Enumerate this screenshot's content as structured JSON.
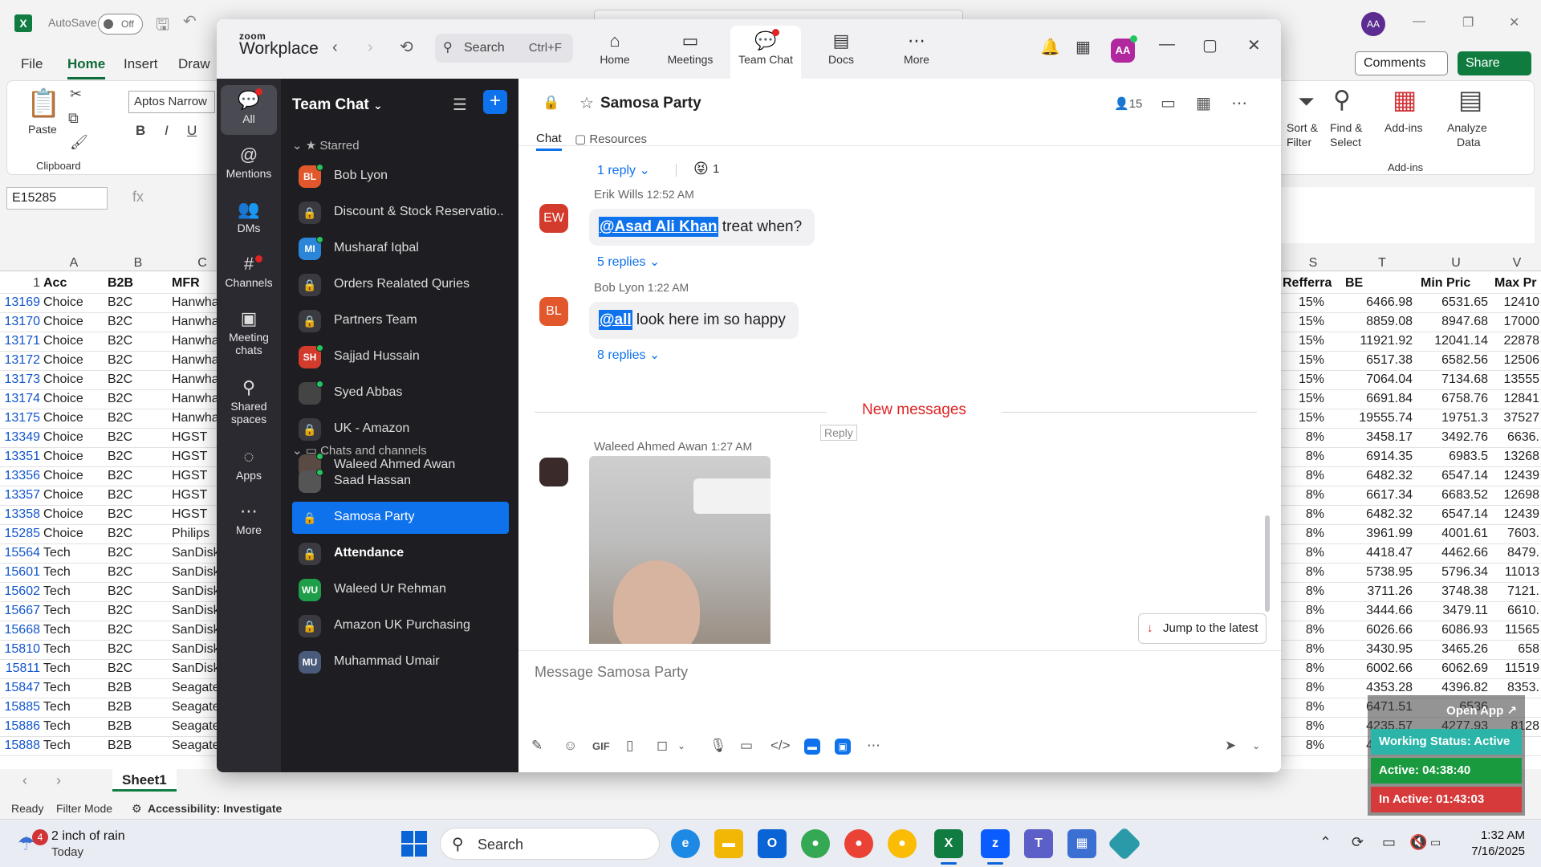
{
  "excel": {
    "autosave_label": "AutoSave",
    "autosave_state": "Off",
    "user_initials": "AA",
    "menu": [
      "File",
      "Home",
      "Insert",
      "Draw"
    ],
    "font_name": "Aptos Narrow",
    "paste_label": "Paste",
    "clipboard_label": "Clipboard",
    "comments_label": "Comments",
    "share_label": "Share",
    "sort_filter_label": "Sort &",
    "sort_filter_label2": "Filter",
    "find_select_label": "Find &",
    "find_select_label2": "Select",
    "addins_label": "Add-ins",
    "addins_group": "Add-ins",
    "analyze_label": "Analyze",
    "analyze_label2": "Data",
    "name_box": "E15285",
    "fx": "fx",
    "col_letters_left": [
      "A",
      "B",
      "C"
    ],
    "col_letters_right": [
      "S",
      "T",
      "U",
      "V"
    ],
    "row1_num": "1",
    "headers_left": [
      "Acc",
      "B2B",
      "MFR"
    ],
    "headers_right": [
      "Refferra",
      "BE",
      "Min Pric",
      "Max Pr"
    ],
    "rows": [
      {
        "n": "13169",
        "a": "Choice",
        "b": "B2C",
        "c": "Hanwha",
        "s": "15%",
        "t": "6466.98",
        "u": "6531.65",
        "v": "12410"
      },
      {
        "n": "13170",
        "a": "Choice",
        "b": "B2C",
        "c": "Hanwha",
        "s": "15%",
        "t": "8859.08",
        "u": "8947.68",
        "v": "17000"
      },
      {
        "n": "13171",
        "a": "Choice",
        "b": "B2C",
        "c": "Hanwha",
        "s": "15%",
        "t": "11921.92",
        "u": "12041.14",
        "v": "22878"
      },
      {
        "n": "13172",
        "a": "Choice",
        "b": "B2C",
        "c": "Hanwha",
        "s": "15%",
        "t": "6517.38",
        "u": "6582.56",
        "v": "12506"
      },
      {
        "n": "13173",
        "a": "Choice",
        "b": "B2C",
        "c": "Hanwha",
        "s": "15%",
        "t": "7064.04",
        "u": "7134.68",
        "v": "13555"
      },
      {
        "n": "13174",
        "a": "Choice",
        "b": "B2C",
        "c": "Hanwha",
        "s": "15%",
        "t": "6691.84",
        "u": "6758.76",
        "v": "12841"
      },
      {
        "n": "13175",
        "a": "Choice",
        "b": "B2C",
        "c": "Hanwha",
        "s": "15%",
        "t": "19555.74",
        "u": "19751.3",
        "v": "37527"
      },
      {
        "n": "13349",
        "a": "Choice",
        "b": "B2C",
        "c": "HGST",
        "s": "8%",
        "t": "3458.17",
        "u": "3492.76",
        "v": "6636."
      },
      {
        "n": "13351",
        "a": "Choice",
        "b": "B2C",
        "c": "HGST",
        "s": "8%",
        "t": "6914.35",
        "u": "6983.5",
        "v": "13268"
      },
      {
        "n": "13356",
        "a": "Choice",
        "b": "B2C",
        "c": "HGST",
        "s": "8%",
        "t": "6482.32",
        "u": "6547.14",
        "v": "12439"
      },
      {
        "n": "13357",
        "a": "Choice",
        "b": "B2C",
        "c": "HGST",
        "s": "8%",
        "t": "6617.34",
        "u": "6683.52",
        "v": "12698"
      },
      {
        "n": "13358",
        "a": "Choice",
        "b": "B2C",
        "c": "HGST",
        "s": "8%",
        "t": "6482.32",
        "u": "6547.14",
        "v": "12439"
      },
      {
        "n": "15285",
        "a": "Choice",
        "b": "B2C",
        "c": "Philips",
        "s": "8%",
        "t": "3961.99",
        "u": "4001.61",
        "v": "7603."
      },
      {
        "n": "15564",
        "a": "Tech",
        "b": "B2C",
        "c": "SanDisk",
        "s": "8%",
        "t": "4418.47",
        "u": "4462.66",
        "v": "8479."
      },
      {
        "n": "15601",
        "a": "Tech",
        "b": "B2C",
        "c": "SanDisk",
        "s": "8%",
        "t": "5738.95",
        "u": "5796.34",
        "v": "11013"
      },
      {
        "n": "15602",
        "a": "Tech",
        "b": "B2C",
        "c": "SanDisk",
        "s": "8%",
        "t": "3711.26",
        "u": "3748.38",
        "v": "7121."
      },
      {
        "n": "15667",
        "a": "Tech",
        "b": "B2C",
        "c": "SanDisk",
        "s": "8%",
        "t": "3444.66",
        "u": "3479.11",
        "v": "6610."
      },
      {
        "n": "15668",
        "a": "Tech",
        "b": "B2C",
        "c": "SanDisk",
        "s": "8%",
        "t": "6026.66",
        "u": "6086.93",
        "v": "11565"
      },
      {
        "n": "15810",
        "a": "Tech",
        "b": "B2C",
        "c": "SanDisk",
        "s": "8%",
        "t": "3430.95",
        "u": "3465.26",
        "v": "658"
      },
      {
        "n": "15811",
        "a": "Tech",
        "b": "B2C",
        "c": "SanDisk",
        "s": "8%",
        "t": "6002.66",
        "u": "6062.69",
        "v": "11519"
      },
      {
        "n": "15847",
        "a": "Tech",
        "b": "B2B",
        "c": "Seagate",
        "s": "8%",
        "t": "4353.28",
        "u": "4396.82",
        "v": "8353."
      },
      {
        "n": "15885",
        "a": "Tech",
        "b": "B2B",
        "c": "Seagate",
        "s": "8%",
        "t": "6471.51",
        "u": "6536",
        "v": ""
      },
      {
        "n": "15886",
        "a": "Tech",
        "b": "B2B",
        "c": "Seagate",
        "s": "8%",
        "t": "4235.57",
        "u": "4277.93",
        "v": "8128"
      },
      {
        "n": "15888",
        "a": "Tech",
        "b": "B2B",
        "c": "Seagate",
        "s": "8%",
        "t": "4641.85",
        "u": "4688.32",
        "v": ""
      }
    ],
    "sheet_name": "Sheet1",
    "status_ready": "Ready",
    "status_filter": "Filter Mode",
    "status_access": "Accessibility: Investigate"
  },
  "zoom": {
    "brand_small": "zoom",
    "brand_big": "Workplace",
    "search_label": "Search",
    "search_shortcut": "Ctrl+F",
    "tabs": [
      {
        "label": "Home",
        "icon": "⌂"
      },
      {
        "label": "Meetings",
        "icon": "▭"
      },
      {
        "label": "Team Chat",
        "icon": "💬"
      },
      {
        "label": "Docs",
        "icon": "▤"
      },
      {
        "label": "More",
        "icon": "⋯"
      }
    ],
    "user_initials": "AA",
    "rail": [
      {
        "label": "All",
        "icon": "💬"
      },
      {
        "label": "Mentions",
        "icon": "@"
      },
      {
        "label": "DMs",
        "icon": "👥"
      },
      {
        "label": "Channels",
        "icon": "#"
      },
      {
        "label": "Meeting chats",
        "icon": "▣"
      },
      {
        "label": "Shared spaces",
        "icon": "⚲"
      },
      {
        "label": "Apps",
        "icon": "◌"
      },
      {
        "label": "More",
        "icon": "⋯"
      }
    ],
    "list_title": "Team Chat",
    "starred_label": "Starred",
    "chats_label": "Chats and channels",
    "starred": [
      {
        "name": "Bob Lyon",
        "initials": "BL",
        "color": "#e2572b",
        "lock": false,
        "online": true
      },
      {
        "name": "Discount & Stock Reservatio...",
        "initials": "",
        "color": "",
        "lock": true,
        "online": false
      },
      {
        "name": "Musharaf Iqbal",
        "initials": "MI",
        "color": "#2b86d9",
        "lock": false,
        "online": true
      },
      {
        "name": "Orders Realated Quries",
        "initials": "",
        "color": "",
        "lock": true,
        "online": false
      },
      {
        "name": "Partners Team",
        "initials": "",
        "color": "",
        "lock": true,
        "online": false
      },
      {
        "name": "Sajjad Hussain",
        "initials": "SH",
        "color": "#d33b2c",
        "lock": false,
        "online": true
      },
      {
        "name": "Syed Abbas",
        "initials": "",
        "color": "#444",
        "lock": false,
        "online": true
      },
      {
        "name": "UK - Amazon",
        "initials": "",
        "color": "",
        "lock": true,
        "online": false
      },
      {
        "name": "Waleed Ahmed Awan",
        "initials": "",
        "color": "#5a4a44",
        "lock": false,
        "online": true
      }
    ],
    "chats": [
      {
        "name": "Saad Hassan",
        "initials": "",
        "color": "#555",
        "lock": false,
        "online": true,
        "sel": false,
        "bold": false
      },
      {
        "name": "Samosa Party",
        "initials": "",
        "color": "",
        "lock": true,
        "online": false,
        "sel": true,
        "bold": false
      },
      {
        "name": "Attendance",
        "initials": "",
        "color": "",
        "lock": true,
        "online": false,
        "sel": false,
        "bold": true
      },
      {
        "name": "Waleed Ur Rehman",
        "initials": "WU",
        "color": "#1f9e4a",
        "lock": false,
        "online": false,
        "sel": false,
        "bold": false
      },
      {
        "name": "Amazon UK Purchasing",
        "initials": "",
        "color": "",
        "lock": true,
        "online": false,
        "sel": false,
        "bold": false
      },
      {
        "name": "Muhammad Umair",
        "initials": "MU",
        "color": "#4a5a7a",
        "lock": false,
        "online": false,
        "sel": false,
        "bold": false
      }
    ],
    "channel_title": "Samosa Party",
    "member_count": "15",
    "chat_tab": "Chat",
    "resources_tab": "Resources",
    "first_reply": "1 reply",
    "first_reaction": "😝",
    "first_reaction_count": "1",
    "messages": [
      {
        "sender": "Erik Wills",
        "time": "12:52 AM",
        "initials": "EW",
        "color": "#d33b2c",
        "mention": "@Asad Ali Khan",
        "text": " treat when?",
        "replies": "5 replies"
      },
      {
        "sender": "Bob Lyon",
        "time": "1:22 AM",
        "initials": "BL",
        "color": "#e2572b",
        "mention": "@all",
        "text": " look here im so happy",
        "replies": "8 replies"
      }
    ],
    "new_messages": "New messages",
    "reply_label": "Reply",
    "last_sender": "Waleed Ahmed Awan",
    "last_time": "1:27 AM",
    "jump_label": "Jump to the latest",
    "compose_placeholder": "Message Samosa Party",
    "gif_label": "GIF"
  },
  "timer": {
    "open_app": "Open App ↗",
    "working": "Working Status: Active",
    "active": "Active: 04:38:40",
    "inactive": "In Active: 01:43:03",
    "colors": {
      "working": "#2ab5a8",
      "active": "#1a9a3e",
      "inactive": "#d63a3a"
    }
  },
  "taskbar": {
    "weather_badge": "4",
    "weather_line1": "2 inch of rain",
    "weather_line2": "Today",
    "search_label": "Search",
    "time": "1:32 AM",
    "date": "7/16/2025"
  }
}
